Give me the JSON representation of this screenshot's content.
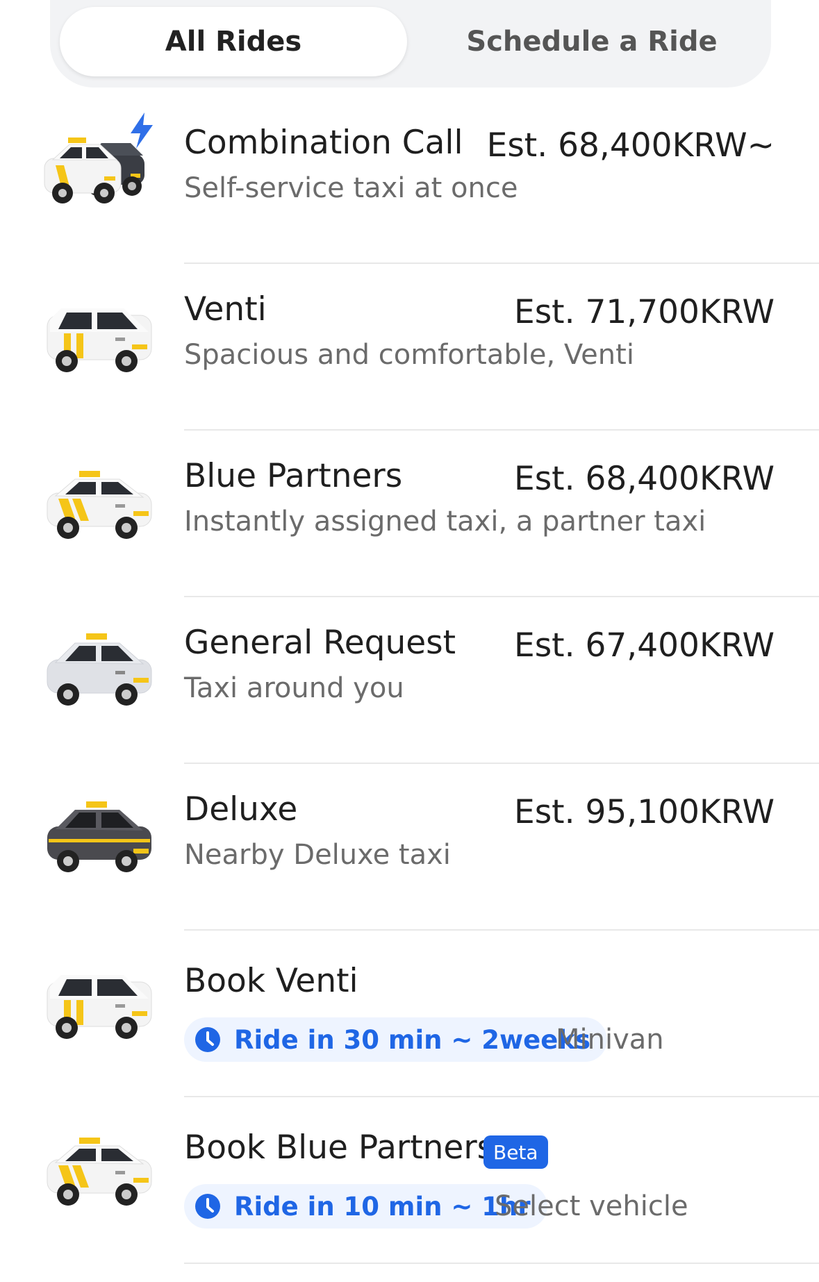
{
  "tabs": {
    "all": "All Rides",
    "schedule": "Schedule a Ride"
  },
  "rides": [
    {
      "title": "Combination Call",
      "subtitle": "Self-service taxi at once",
      "price": "Est. 68,400KRW~",
      "car": "combination"
    },
    {
      "title": "Venti",
      "subtitle": "Spacious and comfortable, Venti",
      "price": "Est. 71,700KRW",
      "car": "venti"
    },
    {
      "title": "Blue Partners",
      "subtitle": "Instantly assigned taxi, a partner taxi",
      "price": "Est. 68,400KRW",
      "car": "blue"
    },
    {
      "title": "General Request",
      "subtitle": "Taxi around you",
      "price": "Est. 67,400KRW",
      "car": "general"
    },
    {
      "title": "Deluxe",
      "subtitle": "Nearby Deluxe taxi",
      "price": "Est. 95,100KRW",
      "car": "deluxe"
    }
  ],
  "bookings": [
    {
      "title": "Book Venti",
      "pill": "Ride in 30 min ~ 2weeks",
      "note": "Minivan"
    },
    {
      "title": "Book Blue Partners",
      "badge": "Beta",
      "pill": "Ride in 10 min ~ 1hr",
      "note": "Select vehicle"
    }
  ],
  "colors": {
    "accent": "#1f66e5",
    "taxi_yellow": "#f5c518",
    "deluxe_body": "#4a4a4f"
  }
}
